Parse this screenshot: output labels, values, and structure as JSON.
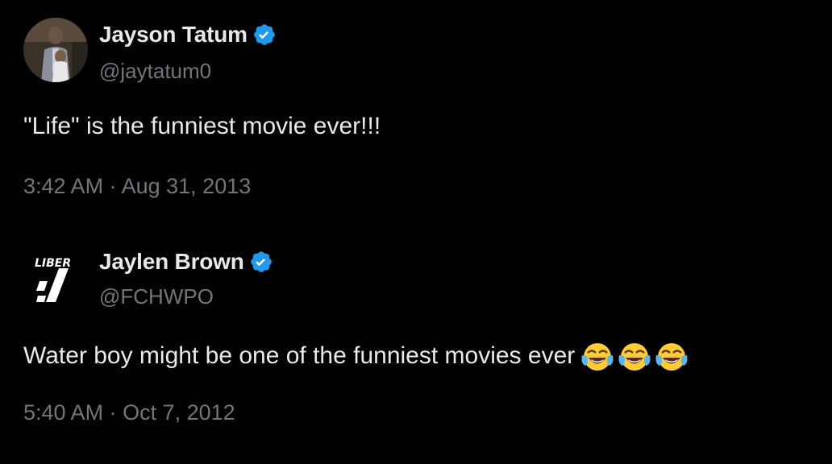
{
  "tweets": [
    {
      "author": {
        "name": "Jayson Tatum",
        "handle": "@jaytatum0",
        "verified": true
      },
      "text": "\"Life\" is the funniest movie ever!!!",
      "time": "3:42 AM",
      "separator": "·",
      "date": "Aug 31, 2013"
    },
    {
      "author": {
        "name": "Jaylen Brown",
        "handle": "@FCHWPO",
        "verified": true,
        "avatar_text": "LIBER"
      },
      "text": "Water boy might be one of the funniest movies ever",
      "emoji": [
        "face-with-tears-of-joy",
        "face-with-tears-of-joy",
        "face-with-tears-of-joy"
      ],
      "time": "5:40 AM",
      "separator": "·",
      "date": "Oct 7, 2012"
    }
  ],
  "colors": {
    "background": "#000000",
    "primary_text": "#e7e9ea",
    "secondary_text": "#71767b",
    "verified_badge": "#1d9bf0"
  }
}
